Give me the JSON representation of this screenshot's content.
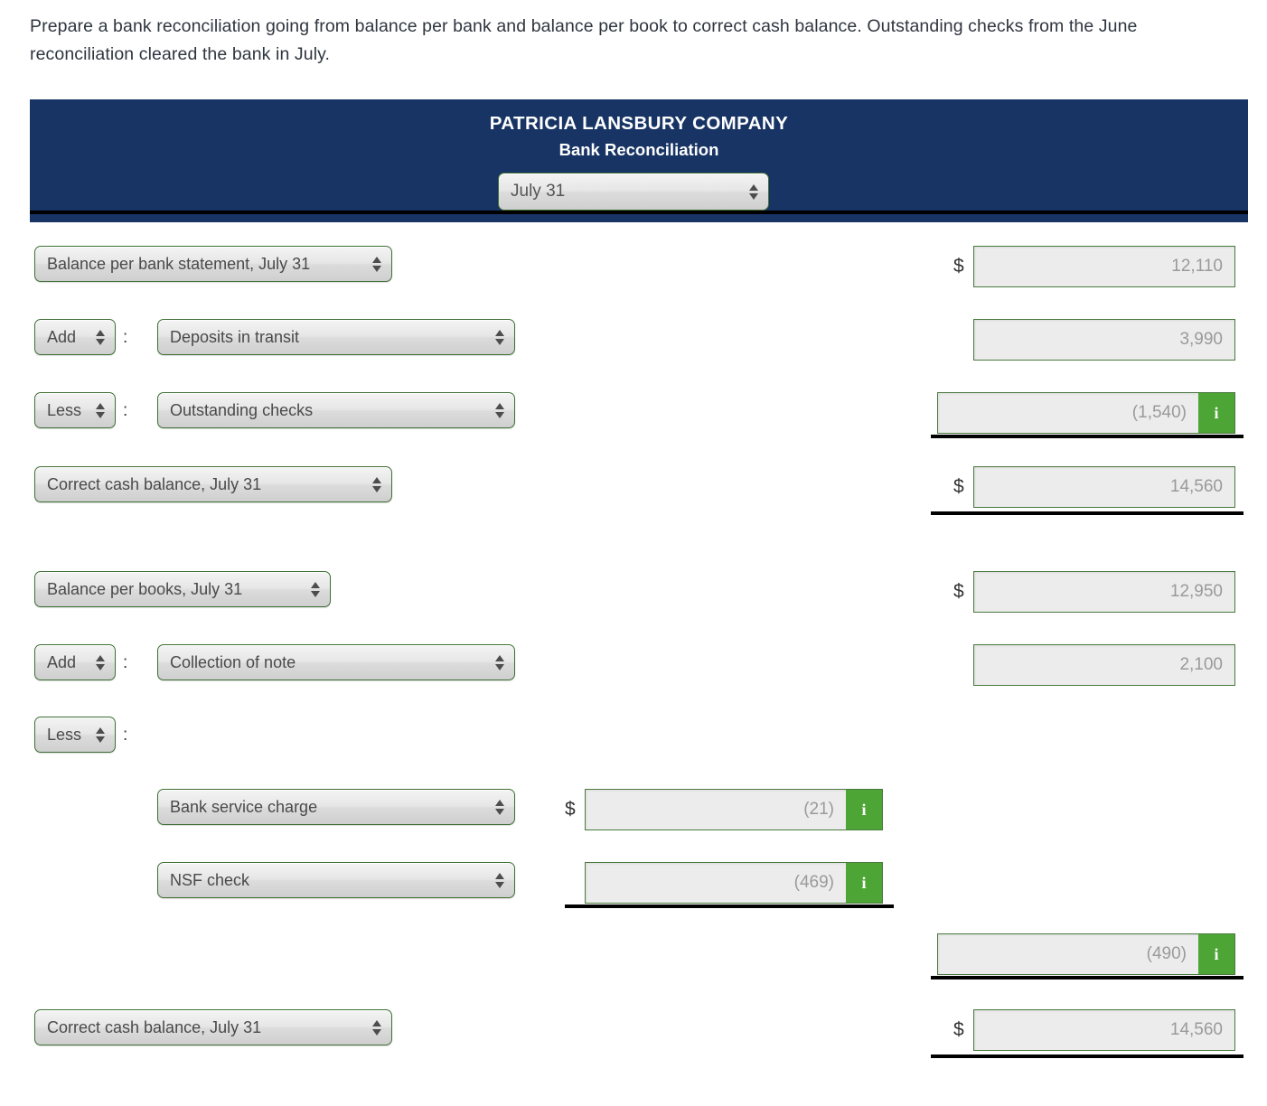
{
  "instructions": "Prepare a bank reconciliation going from balance per bank and balance per book to correct cash balance. Outstanding checks from the June reconciliation cleared the bank in July.",
  "report_header": {
    "company": "PATRICIA LANSBURY COMPANY",
    "statement": "Bank Reconciliation",
    "period_select": "July 31"
  },
  "icons": {
    "info": "i",
    "dollar": "$",
    "colon": ":"
  },
  "colors": {
    "header_navy": "#183464",
    "info_green": "#4CA535",
    "field_border_green": "#4a7a3e",
    "field_bg": "#ececec"
  },
  "bank_section": {
    "rows": [
      {
        "label_select": "Balance per bank statement, July 31",
        "amount": "12,110",
        "dollar": true,
        "info": false
      },
      {
        "prefix_select": "Add",
        "desc_select": "Deposits in transit",
        "amount": "3,990",
        "dollar": false,
        "info": false
      },
      {
        "prefix_select": "Less",
        "desc_select": "Outstanding checks",
        "amount": "(1,540)",
        "dollar": false,
        "info": true
      },
      {
        "label_select": "Correct cash balance, July 31",
        "amount": "14,560",
        "dollar": true,
        "info": false
      }
    ]
  },
  "books_section": {
    "rows": [
      {
        "label_select": "Balance per books, July 31",
        "amount": "12,950",
        "dollar": true,
        "info": false
      },
      {
        "prefix_select": "Add",
        "desc_select": "Collection of note",
        "amount": "2,100",
        "dollar": false,
        "info": false
      },
      {
        "prefix_select": "Less"
      }
    ],
    "deductions": [
      {
        "desc_select": "Bank service charge",
        "amount": "(21)",
        "dollar": true,
        "info": true
      },
      {
        "desc_select": "NSF check",
        "amount": "(469)",
        "dollar": false,
        "info": true
      }
    ],
    "deductions_total": {
      "amount": "(490)",
      "info": true
    },
    "final_row": {
      "label_select": "Correct cash balance, July 31",
      "amount": "14,560",
      "dollar": true,
      "info": false
    }
  }
}
